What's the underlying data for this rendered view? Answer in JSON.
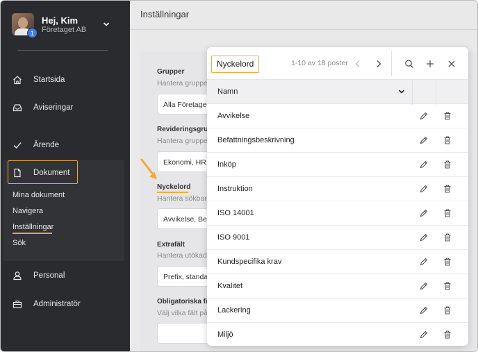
{
  "user": {
    "greeting": "Hej, Kim",
    "company": "Företaget AB",
    "notification_count": "1"
  },
  "sidebar": {
    "items": [
      {
        "label": "Startsida",
        "icon": "home-icon"
      },
      {
        "label": "Aviseringar",
        "icon": "inbox-icon"
      },
      {
        "label": "Ärende",
        "icon": "check-icon"
      },
      {
        "label": "Dokument",
        "icon": "document-icon"
      },
      {
        "label": "Personal",
        "icon": "person-icon"
      },
      {
        "label": "Administratör",
        "icon": "toolbox-icon"
      }
    ],
    "dokument_sub": [
      "Mina dokument",
      "Navigera",
      "Inställningar",
      "Sök"
    ]
  },
  "main": {
    "title": "Inställningar",
    "sections": [
      {
        "title": "Grupper",
        "description": "Hantera gruppe",
        "value": "Alla Företaget"
      },
      {
        "title": "Revideringsgrupp",
        "description": "Hantera gruppe",
        "value": "Ekonomi, HR,"
      },
      {
        "title": "Nyckelord",
        "description": "Hantera sökbar",
        "value": "Avvikelse, Bef"
      },
      {
        "title": "Extrafält",
        "description": "Hantera utökad",
        "value": "Prefix, standa"
      },
      {
        "title": "Obligatoriska fält",
        "description": "Välj vilka fält på",
        "value": ""
      }
    ]
  },
  "popup": {
    "title": "Nyckelord",
    "count": "1-10 av 18 poster",
    "column_header": "Namn",
    "rows": [
      "Avvikelse",
      "Befattningsbeskrivning",
      "Inköp",
      "Instruktion",
      "ISO 14001",
      "ISO 9001",
      "Kundspecifika krav",
      "Kvalitet",
      "Lackering",
      "Miljö"
    ]
  },
  "colors": {
    "sidebar_bg": "#2a2b2e",
    "accent": "#f2a93b",
    "badge": "#3d7df0"
  }
}
